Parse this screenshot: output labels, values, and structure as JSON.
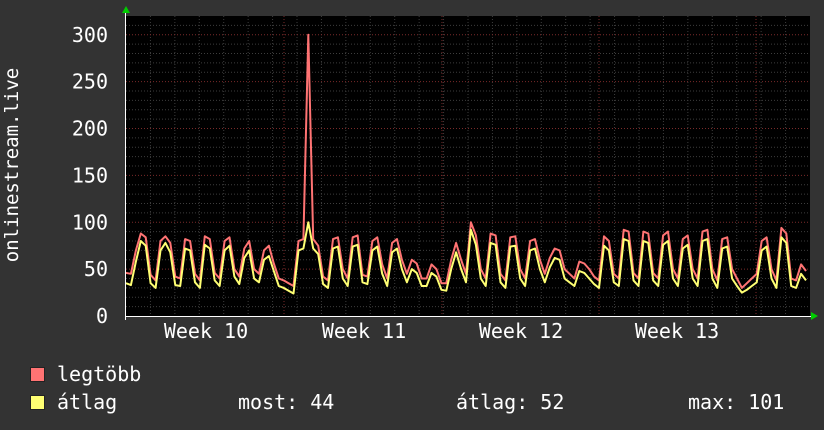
{
  "chart_data": {
    "type": "line",
    "ylabel": "onlinestream.live",
    "ylim": [
      0,
      320
    ],
    "yticks": [
      0,
      50,
      100,
      150,
      200,
      250,
      300
    ],
    "x_tick_labels": [
      "Week 10",
      "Week 11",
      "Week 12",
      "Week 13"
    ],
    "grid": true,
    "colors": {
      "background": "#333333",
      "plot_background": "#000000",
      "major_grid": "#7a2a2a",
      "minor_grid": "#3d3d3d",
      "axis_arrow": "#00cc00"
    },
    "series": [
      {
        "name": "legtöbb",
        "color": "#ff7373",
        "values": [
          46,
          45,
          70,
          88,
          84,
          44,
          38,
          80,
          85,
          78,
          42,
          40,
          82,
          80,
          45,
          38,
          85,
          82,
          46,
          40,
          80,
          84,
          50,
          42,
          72,
          80,
          50,
          45,
          70,
          75,
          56,
          40,
          38,
          35,
          32,
          80,
          82,
          300,
          82,
          75,
          42,
          38,
          82,
          84,
          50,
          40,
          84,
          86,
          44,
          42,
          80,
          84,
          55,
          40,
          78,
          82,
          60,
          45,
          60,
          56,
          40,
          40,
          55,
          50,
          35,
          35,
          60,
          78,
          60,
          45,
          100,
          86,
          50,
          40,
          88,
          86,
          45,
          38,
          84,
          85,
          50,
          40,
          80,
          82,
          60,
          45,
          62,
          72,
          70,
          50,
          45,
          40,
          58,
          56,
          50,
          42,
          38,
          85,
          80,
          45,
          40,
          92,
          90,
          46,
          40,
          90,
          88,
          46,
          40,
          86,
          90,
          50,
          40,
          82,
          86,
          50,
          40,
          90,
          92,
          50,
          38,
          82,
          84,
          50,
          40,
          30,
          35,
          40,
          45,
          80,
          84,
          50,
          38,
          94,
          88,
          40,
          38,
          55,
          48
        ]
      },
      {
        "name": "átlag",
        "color": "#ffff73",
        "values": [
          35,
          33,
          58,
          80,
          75,
          35,
          30,
          70,
          78,
          68,
          33,
          32,
          72,
          70,
          36,
          30,
          76,
          72,
          38,
          32,
          70,
          75,
          42,
          34,
          62,
          70,
          40,
          36,
          60,
          64,
          48,
          32,
          30,
          27,
          24,
          70,
          72,
          100,
          72,
          66,
          34,
          30,
          72,
          74,
          40,
          32,
          74,
          76,
          36,
          34,
          70,
          74,
          45,
          32,
          68,
          72,
          50,
          36,
          50,
          46,
          32,
          32,
          46,
          42,
          28,
          27,
          50,
          68,
          50,
          36,
          92,
          76,
          40,
          32,
          78,
          76,
          36,
          30,
          74,
          75,
          40,
          32,
          70,
          72,
          50,
          36,
          52,
          62,
          60,
          40,
          36,
          32,
          48,
          46,
          40,
          34,
          30,
          75,
          70,
          36,
          32,
          82,
          80,
          38,
          32,
          80,
          78,
          38,
          32,
          76,
          80,
          40,
          32,
          72,
          76,
          40,
          32,
          80,
          82,
          40,
          30,
          72,
          74,
          40,
          32,
          25,
          28,
          32,
          36,
          70,
          74,
          40,
          30,
          84,
          78,
          32,
          30,
          45,
          38
        ]
      }
    ],
    "legend": [
      {
        "label": "legtöbb",
        "color": "#ff7373"
      },
      {
        "label": "átlag",
        "color": "#ffff73"
      }
    ],
    "stats": {
      "most": "most: 44",
      "atlag": "átlag: 52",
      "max": "max: 101"
    }
  }
}
